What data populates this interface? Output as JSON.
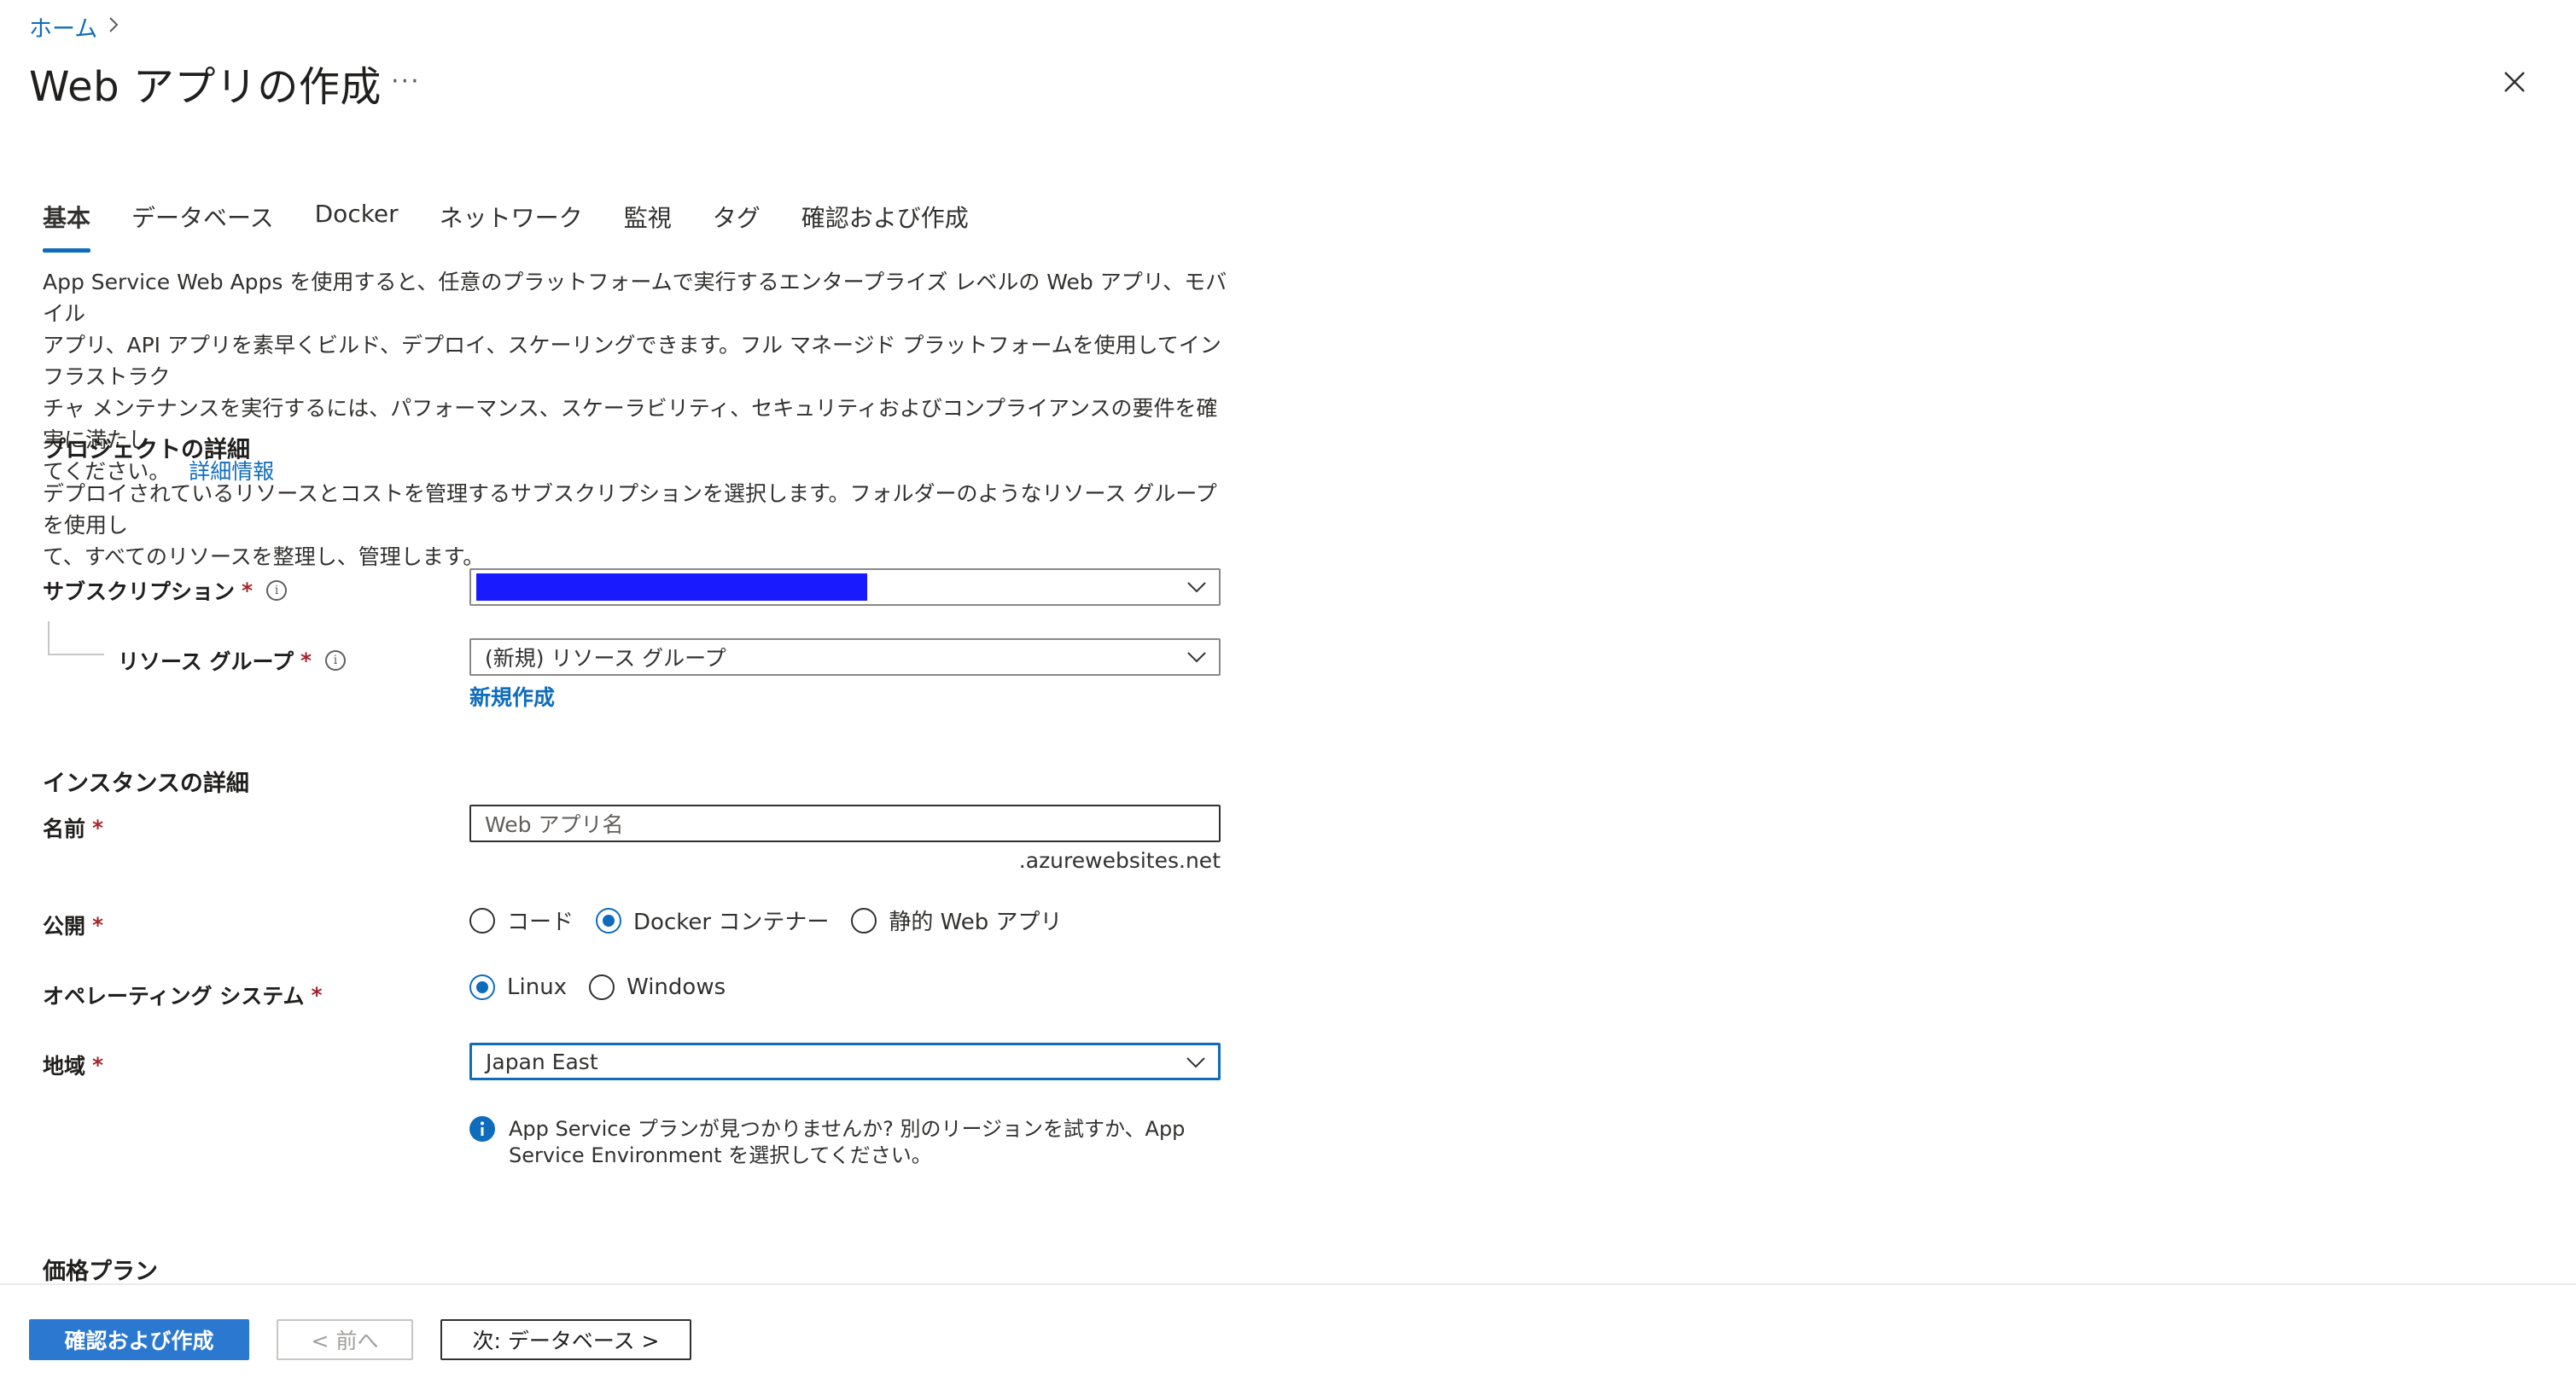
{
  "breadcrumb": {
    "home": "ホーム"
  },
  "header": {
    "title": "Web アプリの作成",
    "more": "···"
  },
  "tabs": [
    {
      "label": "基本"
    },
    {
      "label": "データベース"
    },
    {
      "label": "Docker"
    },
    {
      "label": "ネットワーク"
    },
    {
      "label": "監視"
    },
    {
      "label": "タグ"
    },
    {
      "label": "確認および作成"
    }
  ],
  "intro": {
    "line1": "App Service Web Apps を使用すると、任意のプラットフォームで実行するエンタープライズ レベルの Web アプリ、モバイル",
    "line2": "アプリ、API アプリを素早くビルド、デプロイ、スケーリングできます。フル マネージド プラットフォームを使用してインフラストラク",
    "line3": "チャ メンテナンスを実行するには、パフォーマンス、スケーラビリティ、セキュリティおよびコンプライアンスの要件を確実に満たし",
    "line4": "てください。",
    "learn_more": "詳細情報"
  },
  "project": {
    "heading": "プロジェクトの詳細",
    "desc_line1": "デプロイされているリソースとコストを管理するサブスクリプションを選択します。フォルダーのようなリソース グループを使用し",
    "desc_line2": "て、すべてのリソースを整理し、管理します。",
    "subscription_label": "サブスクリプション",
    "subscription_value": "",
    "resource_group_label": "リソース グループ",
    "resource_group_value": "(新規) リソース グループ",
    "create_new": "新規作成",
    "required": "*"
  },
  "instance": {
    "heading": "インスタンスの詳細",
    "name_label": "名前",
    "name_placeholder": "Web アプリ名",
    "name_suffix": ".azurewebsites.net",
    "publish_label": "公開",
    "publish_options": [
      "コード",
      "Docker コンテナー",
      "静的 Web アプリ"
    ],
    "publish_selected": "Docker コンテナー",
    "os_label": "オペレーティング システム",
    "os_options": [
      "Linux",
      "Windows"
    ],
    "os_selected": "Linux",
    "region_label": "地域",
    "region_value": "Japan East",
    "info_line1": "App Service プランが見つかりませんか? 別のリージョンを試すか、App",
    "info_line2": "Service Environment を選択してください。"
  },
  "pricing": {
    "heading": "価格プラン"
  },
  "footer": {
    "review_create": "確認および作成",
    "previous": "< 前へ",
    "next": "次: データベース >"
  },
  "colors": {
    "accent": "#0f6cbd",
    "primary_button": "#2b78d0",
    "redaction": "#1a1aff",
    "required": "#a4262c"
  }
}
